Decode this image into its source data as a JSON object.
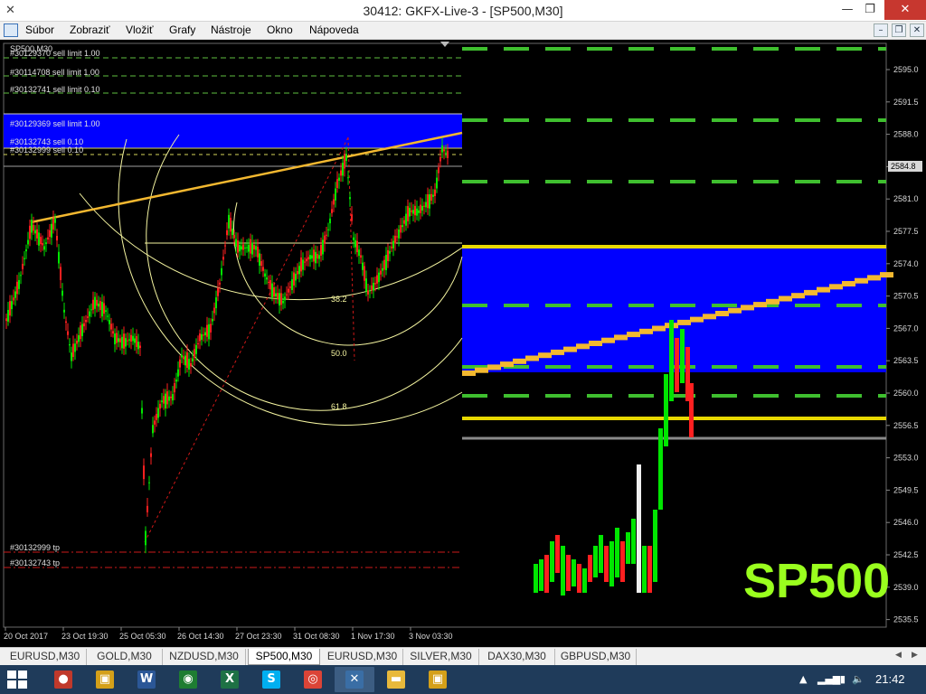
{
  "window": {
    "title": "30412: GKFX-Live-3 - [SP500,M30]",
    "minimize_glyph": "—",
    "restore_glyph": "❐",
    "close_glyph": "✕",
    "app_icon": "mt4-app-icon"
  },
  "menu": {
    "items": [
      "Súbor",
      "Zobraziť",
      "Vložiť",
      "Grafy",
      "Nástroje",
      "Okno",
      "Nápoveda"
    ],
    "mdi_buttons": [
      "–",
      "❐",
      "✕"
    ]
  },
  "chart": {
    "symbol_label": "SP500,M30",
    "watermark": "SP500",
    "colors": {
      "background": "#000000",
      "bull": "#00e600",
      "bear": "#ff2020",
      "order_zone": "#0000ff",
      "trendline": "#f3b830",
      "fib": "#f5f5a0",
      "limit_line": "#5fbf3f",
      "tp_line": "#cc1a1a",
      "price_tag": "#d8d8d8",
      "watermark": "#9aff1e"
    },
    "order_labels": [
      "#30129370 sell limit 1.00",
      "#30114708 sell limit 1.00",
      "#30132741 sell limit 0.10",
      "#30129369 sell limit 1.00",
      "#30132743 sell 0.10",
      "#30132999 sell 0.10",
      "#30132999 tp",
      "#30132743 tp"
    ],
    "fib_levels": [
      "38.2",
      "50.0",
      "61.8"
    ],
    "current_price": "2584.8",
    "price_axis": [
      "2595.0",
      "2591.5",
      "2588.0",
      "2584.5",
      "2581.0",
      "2577.5",
      "2574.0",
      "2570.5",
      "2567.0",
      "2563.5",
      "2560.0",
      "2556.5",
      "2553.0",
      "2549.5",
      "2546.0",
      "2542.5",
      "2539.0",
      "2535.5"
    ],
    "time_axis": [
      "20 Oct 2017",
      "23 Oct 19:30",
      "25 Oct 05:30",
      "26 Oct 14:30",
      "27 Oct 23:30",
      "31 Oct 08:30",
      "1 Nov 17:30",
      "3 Nov 03:30"
    ]
  },
  "tabs": {
    "items": [
      "EURUSD,M30",
      "GOLD,M30",
      "NZDUSD,M30",
      "SP500,M30",
      "EURUSD,M30",
      "SILVER,M30",
      "DAX30,M30",
      "GBPUSD,M30"
    ],
    "active": "SP500,M30",
    "scroll_left": "◀",
    "scroll_right": "▶"
  },
  "taskbar": {
    "apps": [
      {
        "name": "media-app-icon",
        "glyph": "●",
        "color": "#c0392b"
      },
      {
        "name": "gallery-app-icon",
        "glyph": "▣",
        "color": "#d4a019"
      },
      {
        "name": "word-app-icon",
        "glyph": "W",
        "color": "#2b5797"
      },
      {
        "name": "gkfx-app-icon",
        "glyph": "◉",
        "color": "#1e7d32"
      },
      {
        "name": "excel-app-icon",
        "glyph": "X",
        "color": "#1e7145"
      },
      {
        "name": "skype-app-icon",
        "glyph": "S",
        "color": "#00aff0"
      },
      {
        "name": "chrome-app-icon",
        "glyph": "◎",
        "color": "#db4437"
      },
      {
        "name": "mt4-app-icon",
        "glyph": "✕",
        "color": "#3a6ea5"
      },
      {
        "name": "explorer-app-icon",
        "glyph": "▬",
        "color": "#e8b93b"
      },
      {
        "name": "gallery2-app-icon",
        "glyph": "▣",
        "color": "#d4a019"
      }
    ],
    "tray": {
      "up_arrow": "▲",
      "signal": "▂▄▆",
      "battery": "▮",
      "volume": "🔈",
      "clock": "21:42"
    }
  }
}
